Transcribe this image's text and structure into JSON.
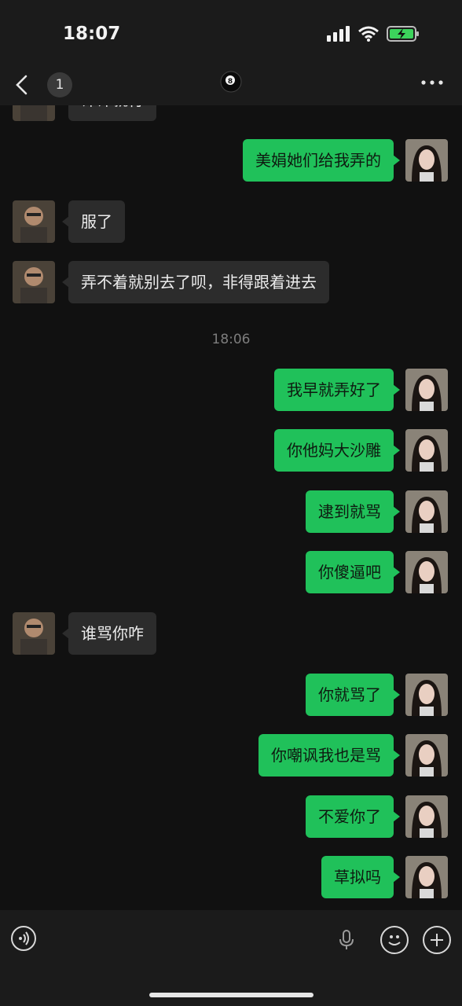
{
  "status_bar": {
    "time": "18:07",
    "icons": [
      "signal-icon",
      "wifi-icon",
      "battery-charging-icon"
    ]
  },
  "nav": {
    "unread_count": "1",
    "title_icon": "billiard-8-ball-icon",
    "more_icon": "more-dots-icon"
  },
  "messages": [
    {
      "side": "in",
      "text": "评评就行"
    },
    {
      "side": "out",
      "text": "美娟她们给我弄的"
    },
    {
      "side": "in",
      "text": "服了"
    },
    {
      "side": "in",
      "text": "弄不着就别去了呗，非得跟着进去"
    },
    {
      "side": "time",
      "text": "18:06"
    },
    {
      "side": "out",
      "text": "我早就弄好了"
    },
    {
      "side": "out",
      "text": "你他妈大沙雕"
    },
    {
      "side": "out",
      "text": "逮到就骂"
    },
    {
      "side": "out",
      "text": "你傻逼吧"
    },
    {
      "side": "in",
      "text": "谁骂你咋"
    },
    {
      "side": "out",
      "text": "你就骂了"
    },
    {
      "side": "out",
      "text": "你嘲讽我也是骂"
    },
    {
      "side": "out",
      "text": "不爱你了"
    },
    {
      "side": "out",
      "text": "草拟吗"
    }
  ],
  "input_bar": {
    "placeholder": "",
    "icons": [
      "voice-icon",
      "mic-icon",
      "emoji-icon",
      "plus-icon"
    ]
  },
  "colors": {
    "outgoing_bubble": "#20c15a",
    "incoming_bubble": "#2c2c2c",
    "background": "#111111",
    "bars": "#1b1b1b"
  }
}
